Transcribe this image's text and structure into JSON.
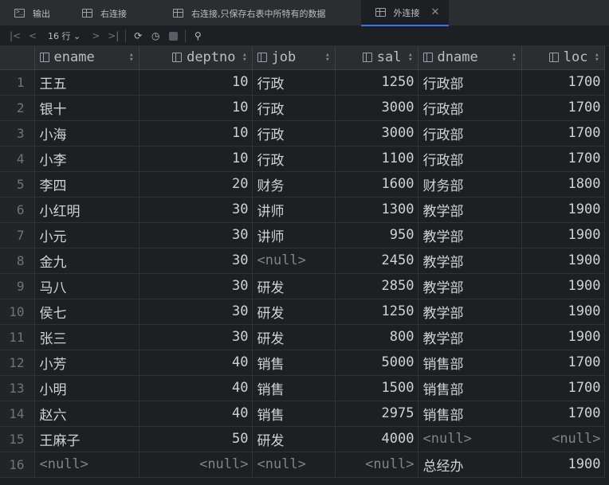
{
  "tabs": [
    {
      "label": "输出",
      "icon": "console-icon",
      "active": false
    },
    {
      "label": "右连接",
      "icon": "table-icon",
      "active": false
    },
    {
      "label": "右连接,只保存右表中所特有的数据",
      "icon": "table-icon",
      "active": false
    },
    {
      "label": "外连接",
      "icon": "table-icon",
      "active": true
    }
  ],
  "toolbar": {
    "rows_label": "16 行",
    "first_icon": "|<",
    "prev_icon": "<",
    "next_icon": ">",
    "last_icon": ">|",
    "refresh_icon": "⟳",
    "history_icon": "◷",
    "pin_icon": "⚲"
  },
  "table": {
    "columns": [
      "ename",
      "deptno",
      "job",
      "sal",
      "dname",
      "loc"
    ],
    "rows": [
      [
        "1",
        "王五",
        "10",
        "行政",
        "1250",
        "行政部",
        "1700"
      ],
      [
        "2",
        "银十",
        "10",
        "行政",
        "3000",
        "行政部",
        "1700"
      ],
      [
        "3",
        "小海",
        "10",
        "行政",
        "3000",
        "行政部",
        "1700"
      ],
      [
        "4",
        "小李",
        "10",
        "行政",
        "1100",
        "行政部",
        "1700"
      ],
      [
        "5",
        "李四",
        "20",
        "财务",
        "1600",
        "财务部",
        "1800"
      ],
      [
        "6",
        "小红明",
        "30",
        "讲师",
        "1300",
        "教学部",
        "1900"
      ],
      [
        "7",
        "小元",
        "30",
        "讲师",
        "950",
        "教学部",
        "1900"
      ],
      [
        "8",
        "金九",
        "30",
        "<null>",
        "2450",
        "教学部",
        "1900"
      ],
      [
        "9",
        "马八",
        "30",
        "研发",
        "2850",
        "教学部",
        "1900"
      ],
      [
        "10",
        "侯七",
        "30",
        "研发",
        "1250",
        "教学部",
        "1900"
      ],
      [
        "11",
        "张三",
        "30",
        "研发",
        "800",
        "教学部",
        "1900"
      ],
      [
        "12",
        "小芳",
        "40",
        "销售",
        "5000",
        "销售部",
        "1700"
      ],
      [
        "13",
        "小明",
        "40",
        "销售",
        "1500",
        "销售部",
        "1700"
      ],
      [
        "14",
        "赵六",
        "40",
        "销售",
        "2975",
        "销售部",
        "1700"
      ],
      [
        "15",
        "王麻子",
        "50",
        "研发",
        "4000",
        "<null>",
        "<null>"
      ],
      [
        "16",
        "<null>",
        "<null>",
        "<null>",
        "<null>",
        "总经办",
        "1900"
      ]
    ]
  }
}
